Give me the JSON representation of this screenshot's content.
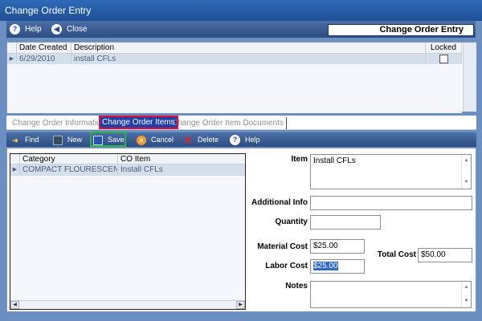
{
  "window": {
    "title": "Change Order Entry"
  },
  "toolbar": {
    "help_label": "Help",
    "close_label": "Close",
    "header_title": "Change Order Entry"
  },
  "orders_grid": {
    "columns": [
      "Date Created",
      "Description",
      "Locked"
    ],
    "rows": [
      {
        "date": "6/29/2010",
        "description": "install CFLs",
        "locked": false
      }
    ]
  },
  "tabs": [
    {
      "label": "Change Order Information"
    },
    {
      "label": "Change Order Items"
    },
    {
      "label": "Change Order Item Documents"
    }
  ],
  "item_toolbar": {
    "find_label": "Find",
    "new_label": "New",
    "save_label": "Save",
    "cancel_label": "Cancel",
    "delete_label": "Delete",
    "help_label": "Help"
  },
  "items_grid": {
    "columns": [
      "Category",
      "CO Item"
    ],
    "rows": [
      {
        "category": "COMPACT FLOURESCENT...",
        "item": "Install CFLs"
      }
    ]
  },
  "form": {
    "item_label": "Item",
    "item_value": "Install CFLs",
    "additional_info_label": "Additional Info",
    "additional_info_value": "",
    "quantity_label": "Quantity",
    "quantity_value": "",
    "material_cost_label": "Material Cost",
    "material_cost_value": "$25.00",
    "labor_cost_label": "Labor Cost",
    "labor_cost_value": "$25.00",
    "total_cost_label": "Total Cost",
    "total_cost_value": "$50.00",
    "notes_label": "Notes",
    "notes_value": ""
  }
}
